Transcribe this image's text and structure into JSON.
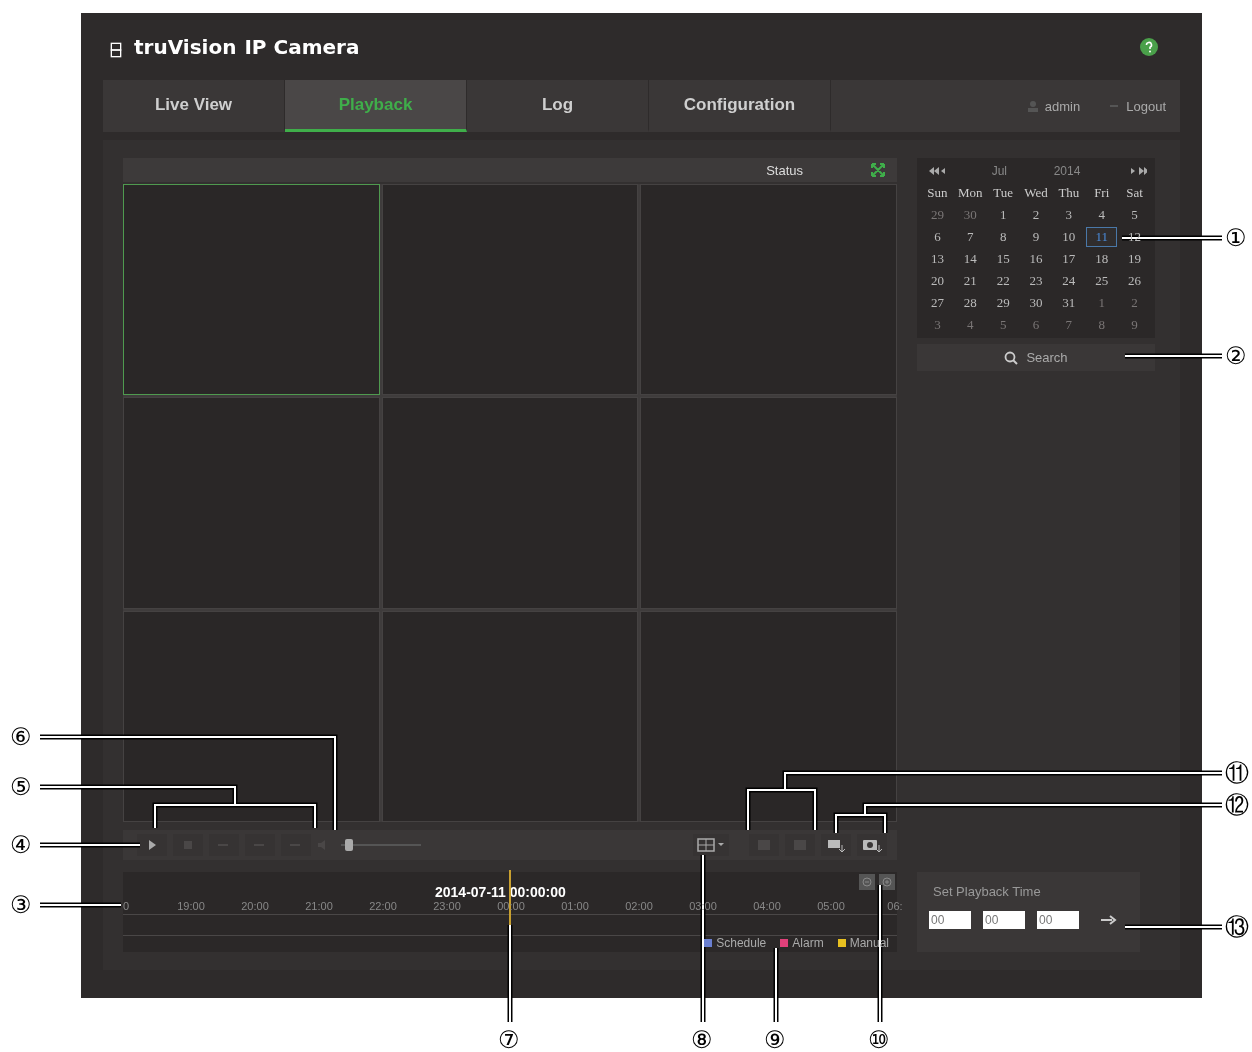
{
  "header": {
    "logo": "truVision",
    "product": "IP Camera"
  },
  "nav": {
    "tabs": [
      {
        "label": "Live View",
        "selected": false
      },
      {
        "label": "Playback",
        "selected": true
      },
      {
        "label": "Log",
        "selected": false
      },
      {
        "label": "Configuration",
        "selected": false
      }
    ],
    "user": "admin",
    "logout": "Logout"
  },
  "video": {
    "status": "Status",
    "cells": [
      {
        "selected": true
      },
      {
        "selected": false
      },
      {
        "selected": false
      },
      {
        "selected": false
      },
      {
        "selected": false
      },
      {
        "selected": false
      },
      {
        "selected": false
      },
      {
        "selected": false
      },
      {
        "selected": false
      }
    ]
  },
  "controls": {
    "volume": {
      "level": 0.05
    }
  },
  "timeline": {
    "current": "2014-07-11 00:00:00",
    "ticks": [
      "0",
      "19:00",
      "20:00",
      "21:00",
      "22:00",
      "23:00",
      "00:00",
      "01:00",
      "02:00",
      "03:00",
      "04:00",
      "05:00",
      "06:"
    ],
    "legend": [
      {
        "label": "Schedule",
        "color": "#6a7fd0"
      },
      {
        "label": "Alarm",
        "color": "#e0407a"
      },
      {
        "label": "Manual",
        "color": "#e8c020"
      }
    ]
  },
  "calendar": {
    "month": "Jul",
    "year": "2014",
    "weekdays": [
      "Sun",
      "Mon",
      "Tue",
      "Wed",
      "Thu",
      "Fri",
      "Sat"
    ],
    "days": [
      {
        "day": "29",
        "other_month": true,
        "selected": false
      },
      {
        "day": "30",
        "other_month": true,
        "selected": false
      },
      {
        "day": "1",
        "other_month": false,
        "selected": false
      },
      {
        "day": "2",
        "other_month": false,
        "selected": false
      },
      {
        "day": "3",
        "other_month": false,
        "selected": false
      },
      {
        "day": "4",
        "other_month": false,
        "selected": false
      },
      {
        "day": "5",
        "other_month": false,
        "selected": false
      },
      {
        "day": "6",
        "other_month": false,
        "selected": false
      },
      {
        "day": "7",
        "other_month": false,
        "selected": false
      },
      {
        "day": "8",
        "other_month": false,
        "selected": false
      },
      {
        "day": "9",
        "other_month": false,
        "selected": false
      },
      {
        "day": "10",
        "other_month": false,
        "selected": false
      },
      {
        "day": "11",
        "other_month": false,
        "selected": true
      },
      {
        "day": "12",
        "other_month": false,
        "selected": false
      },
      {
        "day": "13",
        "other_month": false,
        "selected": false
      },
      {
        "day": "14",
        "other_month": false,
        "selected": false
      },
      {
        "day": "15",
        "other_month": false,
        "selected": false
      },
      {
        "day": "16",
        "other_month": false,
        "selected": false
      },
      {
        "day": "17",
        "other_month": false,
        "selected": false
      },
      {
        "day": "18",
        "other_month": false,
        "selected": false
      },
      {
        "day": "19",
        "other_month": false,
        "selected": false
      },
      {
        "day": "20",
        "other_month": false,
        "selected": false
      },
      {
        "day": "21",
        "other_month": false,
        "selected": false
      },
      {
        "day": "22",
        "other_month": false,
        "selected": false
      },
      {
        "day": "23",
        "other_month": false,
        "selected": false
      },
      {
        "day": "24",
        "other_month": false,
        "selected": false
      },
      {
        "day": "25",
        "other_month": false,
        "selected": false
      },
      {
        "day": "26",
        "other_month": false,
        "selected": false
      },
      {
        "day": "27",
        "other_month": false,
        "selected": false
      },
      {
        "day": "28",
        "other_month": false,
        "selected": false
      },
      {
        "day": "29",
        "other_month": false,
        "selected": false
      },
      {
        "day": "30",
        "other_month": false,
        "selected": false
      },
      {
        "day": "31",
        "other_month": false,
        "selected": false
      },
      {
        "day": "1",
        "other_month": true,
        "selected": false
      },
      {
        "day": "2",
        "other_month": true,
        "selected": false
      },
      {
        "day": "3",
        "other_month": true,
        "selected": false
      },
      {
        "day": "4",
        "other_month": true,
        "selected": false
      },
      {
        "day": "5",
        "other_month": true,
        "selected": false
      },
      {
        "day": "6",
        "other_month": true,
        "selected": false
      },
      {
        "day": "7",
        "other_month": true,
        "selected": false
      },
      {
        "day": "8",
        "other_month": true,
        "selected": false
      },
      {
        "day": "9",
        "other_month": true,
        "selected": false
      }
    ],
    "search": "Search"
  },
  "playback_time": {
    "title": "Set Playback Time",
    "hour": "00",
    "minute": "00",
    "second": "00"
  },
  "callouts": [
    "①",
    "②",
    "⑥",
    "⑪",
    "⑤",
    "⑫",
    "④",
    "③",
    "⑬",
    "⑦",
    "⑧",
    "⑨",
    "⑩"
  ]
}
